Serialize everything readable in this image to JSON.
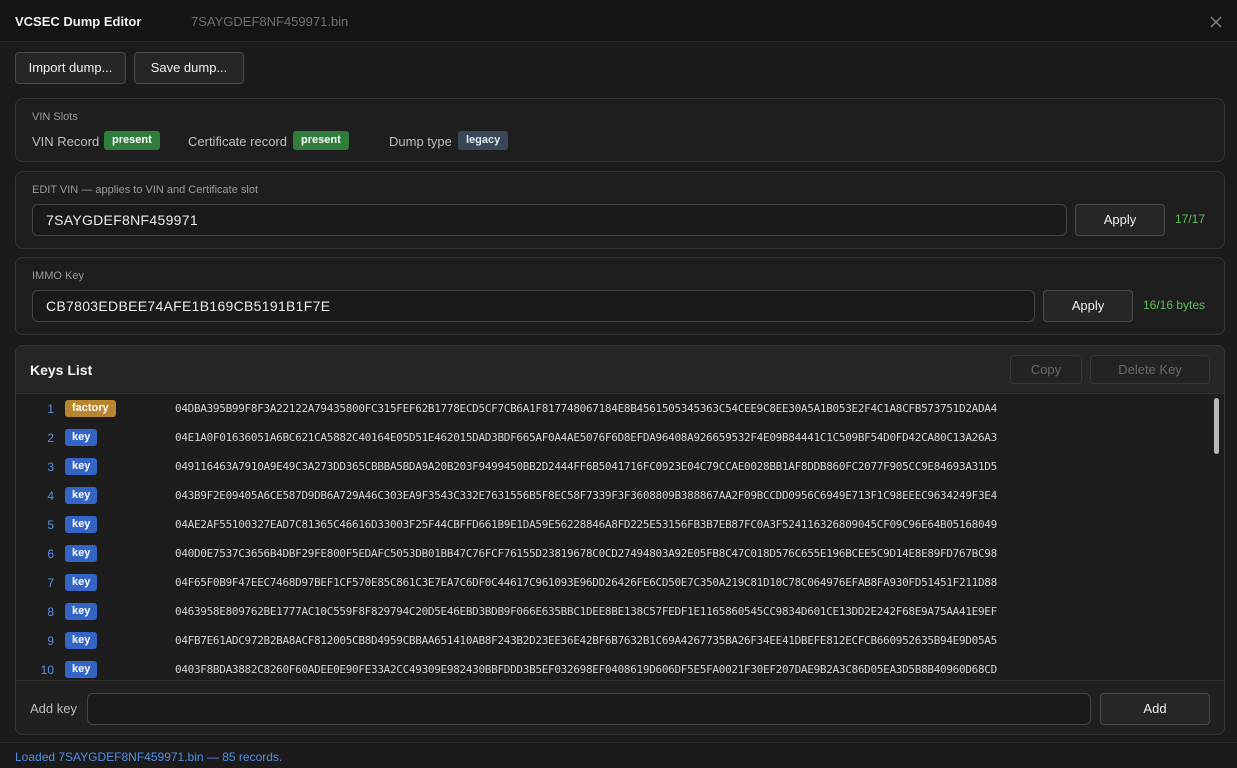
{
  "window": {
    "app_title": "VCSEC Dump Editor",
    "file_title": "7SAYGDEF8NF459971.bin",
    "close_icon": "close-icon"
  },
  "toolbar": {
    "import_label": "Import dump...",
    "save_label": "Save dump..."
  },
  "vin_slots": {
    "title": "VIN Slots",
    "vin_record_label": "VIN Record",
    "vin_record_status": "present",
    "cert_record_label": "Certificate record",
    "cert_record_status": "present",
    "dump_type_label": "Dump type",
    "dump_type_value": "legacy"
  },
  "edit_vin": {
    "title": "EDIT VIN — applies to VIN and Certificate slot",
    "value": "7SAYGDEF8NF459971",
    "apply_label": "Apply",
    "counter": "17/17"
  },
  "immo_key": {
    "title": "IMMO Key",
    "value": "CB7803EDBEE74AFE1B169CB5191B1F7E",
    "apply_label": "Apply",
    "counter": "16/16 bytes"
  },
  "keys_list": {
    "title": "Keys List",
    "copy_label": "Copy",
    "delete_label": "Delete Key",
    "rows": [
      {
        "num": "1",
        "type": "factory",
        "hex": "04DBA395B99F8F3A22122A79435800FC315FEF62B1778ECD5CF7CB6A1F817748067184E8B4561505345363C54CEE9C8EE30A5A1B053E2F4C1A8CFB573751D2ADA4"
      },
      {
        "num": "2",
        "type": "key",
        "hex": "04E1A0F01636051A6BC621CA5882C40164E05D51E462015DAD3BDF665AF0A4AE5076F6D8EFDA96408A926659532F4E09B84441C1C509BF54D0FD42CA80C13A26A3"
      },
      {
        "num": "3",
        "type": "key",
        "hex": "049116463A7910A9E49C3A273DD365CBBBA5BDA9A20B203F9499450BB2D2444FF6B5041716FC0923E04C79CCAE0028BB1AF8DDB860FC2077F905CC9E84693A31D5"
      },
      {
        "num": "4",
        "type": "key",
        "hex": "043B9F2E09405A6CE587D9DB6A729A46C303EA9F3543C332E7631556B5F8EC58F7339F3F3608809B388867AA2F09BCCDD0956C6949E713F1C98EEEC9634249F3E4"
      },
      {
        "num": "5",
        "type": "key",
        "hex": "04AE2AF55100327EAD7C81365C46616D33003F25F44CBFFD661B9E1DA59E56228846A8FD225E53156FB3B7EB87FC0A3F524116326809045CF09C96E64B05168049"
      },
      {
        "num": "6",
        "type": "key",
        "hex": "040D0E7537C3656B4DBF29FE800F5EDAFC5053DB01BB47C76FCF76155D23819678C0CD27494803A92E05FB8C47C018D576C655E196BCEE5C9D14E8E89FD767BC98"
      },
      {
        "num": "7",
        "type": "key",
        "hex": "04F65F0B9F47EEC7468D97BEF1CF570E85C861C3E7EA7C6DF0C44617C961093E96DD26426FE6CD50E7C350A219C81D10C78C064976EFAB8FA930FD51451F211D88"
      },
      {
        "num": "8",
        "type": "key",
        "hex": "0463958E809762BE1777AC10C559F8F829794C20D5E46EBD3BDB9F066E635BBC1DEE8BE138C57FEDF1E1165860545CC9834D601CE13DD2E242F68E9A75AA41E9EF"
      },
      {
        "num": "9",
        "type": "key",
        "hex": "04FB7E61ADC972B2BA8ACF812005CB8D4959CBBAA651410AB8F243B2D23EE36E42BF6B7632B1C69A4267735BA26F34EE41DBEFE812ECFCB660952635B94E9D05A5"
      },
      {
        "num": "10",
        "type": "key",
        "hex": "0403F8BDA3882C8260F60ADEE0E90FE33A2CC49309E982430BBFDDD3B5EF032698EF0408619D606DF5E5FA0021F30EF207DAE9B2A3C86D05EA3D5B8B40960D68CD"
      }
    ]
  },
  "add_key": {
    "label": "Add key",
    "placeholder": "",
    "value": "",
    "add_label": "Add"
  },
  "status": {
    "text": "Loaded 7SAYGDEF8NF459971.bin — 85 records."
  },
  "colors": {
    "accent_blue": "#3465c6",
    "factory_gold": "#b7862e",
    "present_green": "#2f7d3b",
    "counter_green": "#5cbf5c",
    "status_blue": "#4f8fe8"
  }
}
